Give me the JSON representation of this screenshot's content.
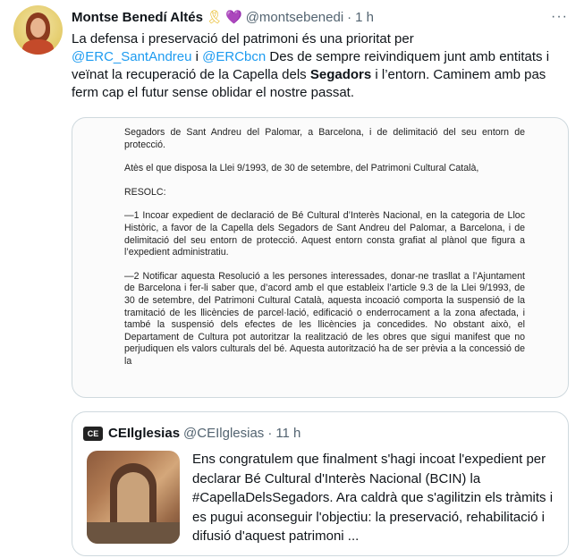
{
  "tweet": {
    "author_name": "Montse Benedí Altés",
    "emoji_ribbon": "🎗",
    "emoji_heart": "💜",
    "handle": "@montsebenedi",
    "separator": "·",
    "time": "1 h",
    "more": "···",
    "text": {
      "line1": "La defensa i preservació del patrimoni és una prioritat per",
      "mention1": "@ERC_SantAndreu",
      "conj": " i ",
      "mention2": "@ERCbcn",
      "after_mentions": " Des de sempre reivindiquem junt amb entitats i veïnat la recuperació de la Capella dels ",
      "bold_word": "Segadors",
      "after_bold": " i l’entorn. Caminem amb pas ferm cap el futur sense oblidar el nostre passat."
    }
  },
  "document": {
    "p1": "Segadors de Sant Andreu del Palomar, a Barcelona, i de delimitació del seu entorn de protecció.",
    "p2": "Atès el que disposa la Llei 9/1993, de 30 de setembre, del Patrimoni Cultural Català,",
    "p3": "RESOLC:",
    "p4": "—1 Incoar expedient de declaració de Bé Cultural d’Interès Nacional, en la categoria de Lloc Històric, a favor de la Capella dels Segadors de Sant Andreu del Palomar, a Barcelona, i de delimitació del seu entorn de protecció. Aquest entorn consta grafiat al plànol que figura a l’expedient administratiu.",
    "p5": "—2 Notificar aquesta Resolució a les persones interessades, donar-ne trasllat a l’Ajuntament de Barcelona i fer-li saber que, d’acord amb el que estableix l’article 9.3 de la Llei 9/1993, de 30 de setembre, del Patrimoni Cultural Català, aquesta incoació comporta la suspensió de la tramitació de les llicències de parcel·lació, edificació o enderrocament a la zona afectada, i també la suspensió dels efectes de les llicències ja concedides. No obstant això, el Departament de Cultura pot autoritzar la realització de les obres que sigui manifest que no perjudiquen els valors culturals del bé. Aquesta autorització ha de ser prèvia a la concessió de la"
  },
  "quote": {
    "avatar_text": "CE",
    "name": "CEIlglesias",
    "handle": "@CEIlglesias",
    "separator": "·",
    "time": "11 h",
    "text": "Ens congratulem que finalment s'hagi incoat l'expedient per declarar Bé Cultural d'Interès Nacional (BCIN) la #CapellaDelsSegadors. Ara caldrà que s'agilitzin els tràmits i es pugui aconseguir l'objectiu: la preservació, rehabilitació i difusió d'aquest patrimoni ..."
  }
}
